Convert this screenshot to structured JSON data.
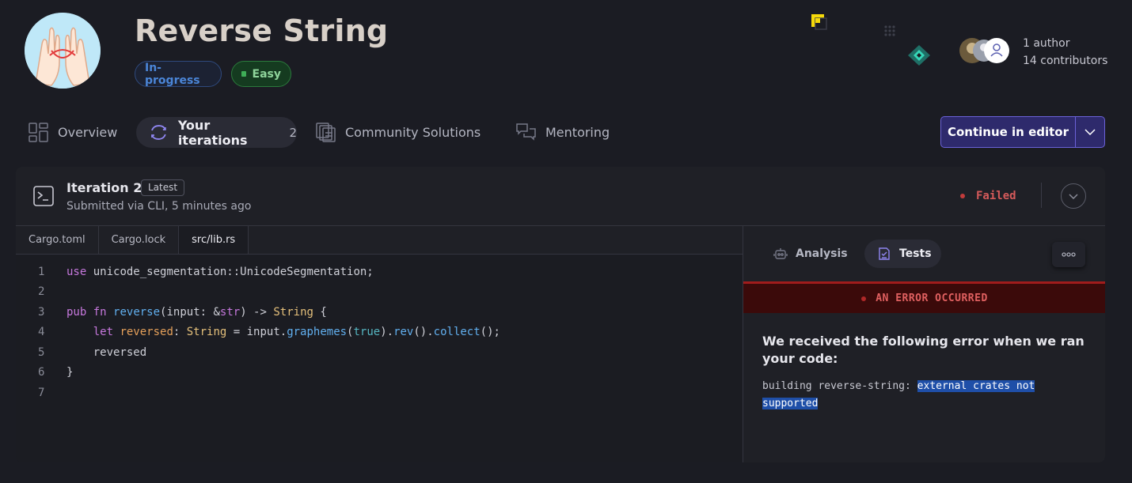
{
  "header": {
    "title": "Reverse String",
    "status_badge": "In-progress",
    "difficulty_badge": "Easy",
    "authors": "1 author",
    "contributors": "14 contributors"
  },
  "tabs": [
    {
      "label": "Overview"
    },
    {
      "label": "Your iterations",
      "count": "2"
    },
    {
      "label": "Community Solutions"
    },
    {
      "label": "Mentoring"
    }
  ],
  "continue_button": "Continue in editor",
  "iteration": {
    "title": "Iteration 2",
    "latest_badge": "Latest",
    "submitted": "Submitted via CLI, 5 minutes ago",
    "status": "Failed"
  },
  "files": [
    "Cargo.toml",
    "Cargo.lock",
    "src/lib.rs"
  ],
  "code": {
    "line_numbers": [
      "1",
      "2",
      "3",
      "4",
      "5",
      "6",
      "7"
    ],
    "lines": [
      "use unicode_segmentation::UnicodeSegmentation;",
      "",
      "pub fn reverse(input: &str) -> String {",
      "    let reversed: String = input.graphemes(true).rev().collect();",
      "    reversed",
      "}",
      ""
    ]
  },
  "side_tabs": [
    {
      "label": "Analysis"
    },
    {
      "label": "Tests"
    }
  ],
  "error": {
    "banner": "AN ERROR OCCURRED",
    "heading": "We received the following error when we ran your code:",
    "message_prefix": "building reverse-string: ",
    "message_selected": "external crates not supported"
  },
  "colors": {
    "accent": "#6b62d8",
    "failed": "#d45a5a",
    "easy": "#3fae57",
    "in_progress": "#4b86d8"
  }
}
